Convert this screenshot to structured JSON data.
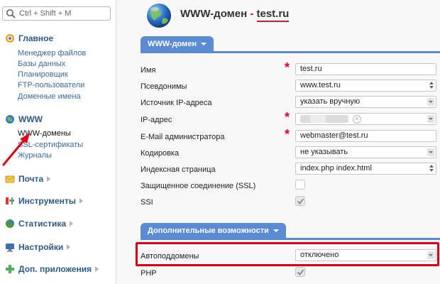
{
  "sidebar": {
    "search_placeholder": "Ctrl + Shift + M",
    "sections": [
      {
        "label": "Главное",
        "icon": "gear-icon",
        "items": [
          "Менеджер файлов",
          "Базы данных",
          "Планировщик",
          "FTP-пользователи",
          "Доменные имена"
        ]
      },
      {
        "label": "WWW",
        "icon": "globe-icon",
        "items": [
          "WWW-домены",
          "SSL-сертификаты",
          "Журналы"
        ]
      },
      {
        "label": "Почта",
        "icon": "mail-icon"
      },
      {
        "label": "Инструменты",
        "icon": "tools-icon"
      },
      {
        "label": "Статистика",
        "icon": "pie-chart-icon"
      },
      {
        "label": "Настройки",
        "icon": "settings-monitor-icon"
      },
      {
        "label": "Доп. приложения",
        "icon": "plus-icon"
      }
    ],
    "active_item": "WWW-домены"
  },
  "header": {
    "title_prefix": "WWW-домен",
    "title_dash": "-",
    "title_domain": "test.ru"
  },
  "form": {
    "tab_main": "WWW-домен",
    "tab_extra": "Дополнительные возможности",
    "fields": {
      "name": {
        "label": "Имя",
        "value": "test.ru"
      },
      "aliases": {
        "label": "Псевдонимы",
        "value": "www.test.ru"
      },
      "ip_source": {
        "label": "Источник IP-адреса",
        "value": "указать вручную"
      },
      "ip": {
        "label": "IP-адрес"
      },
      "email": {
        "label": "E-Mail администратора",
        "value": "webmaster@test.ru"
      },
      "encoding": {
        "label": "Кодировка",
        "value": "не указывать"
      },
      "index": {
        "label": "Индексная страница",
        "value": "index.php index.html"
      },
      "ssl": {
        "label": "Защищенное соединение (SSL)",
        "checked": false
      },
      "ssi": {
        "label": "SSI",
        "checked": true
      },
      "autosubdomains": {
        "label": "Автоподдомены",
        "value": "отключено"
      },
      "php": {
        "label": "PHP",
        "checked": true
      }
    }
  },
  "colors": {
    "accent": "#5b8bd3",
    "link": "#3b6aa0",
    "highlight": "#e00012"
  }
}
